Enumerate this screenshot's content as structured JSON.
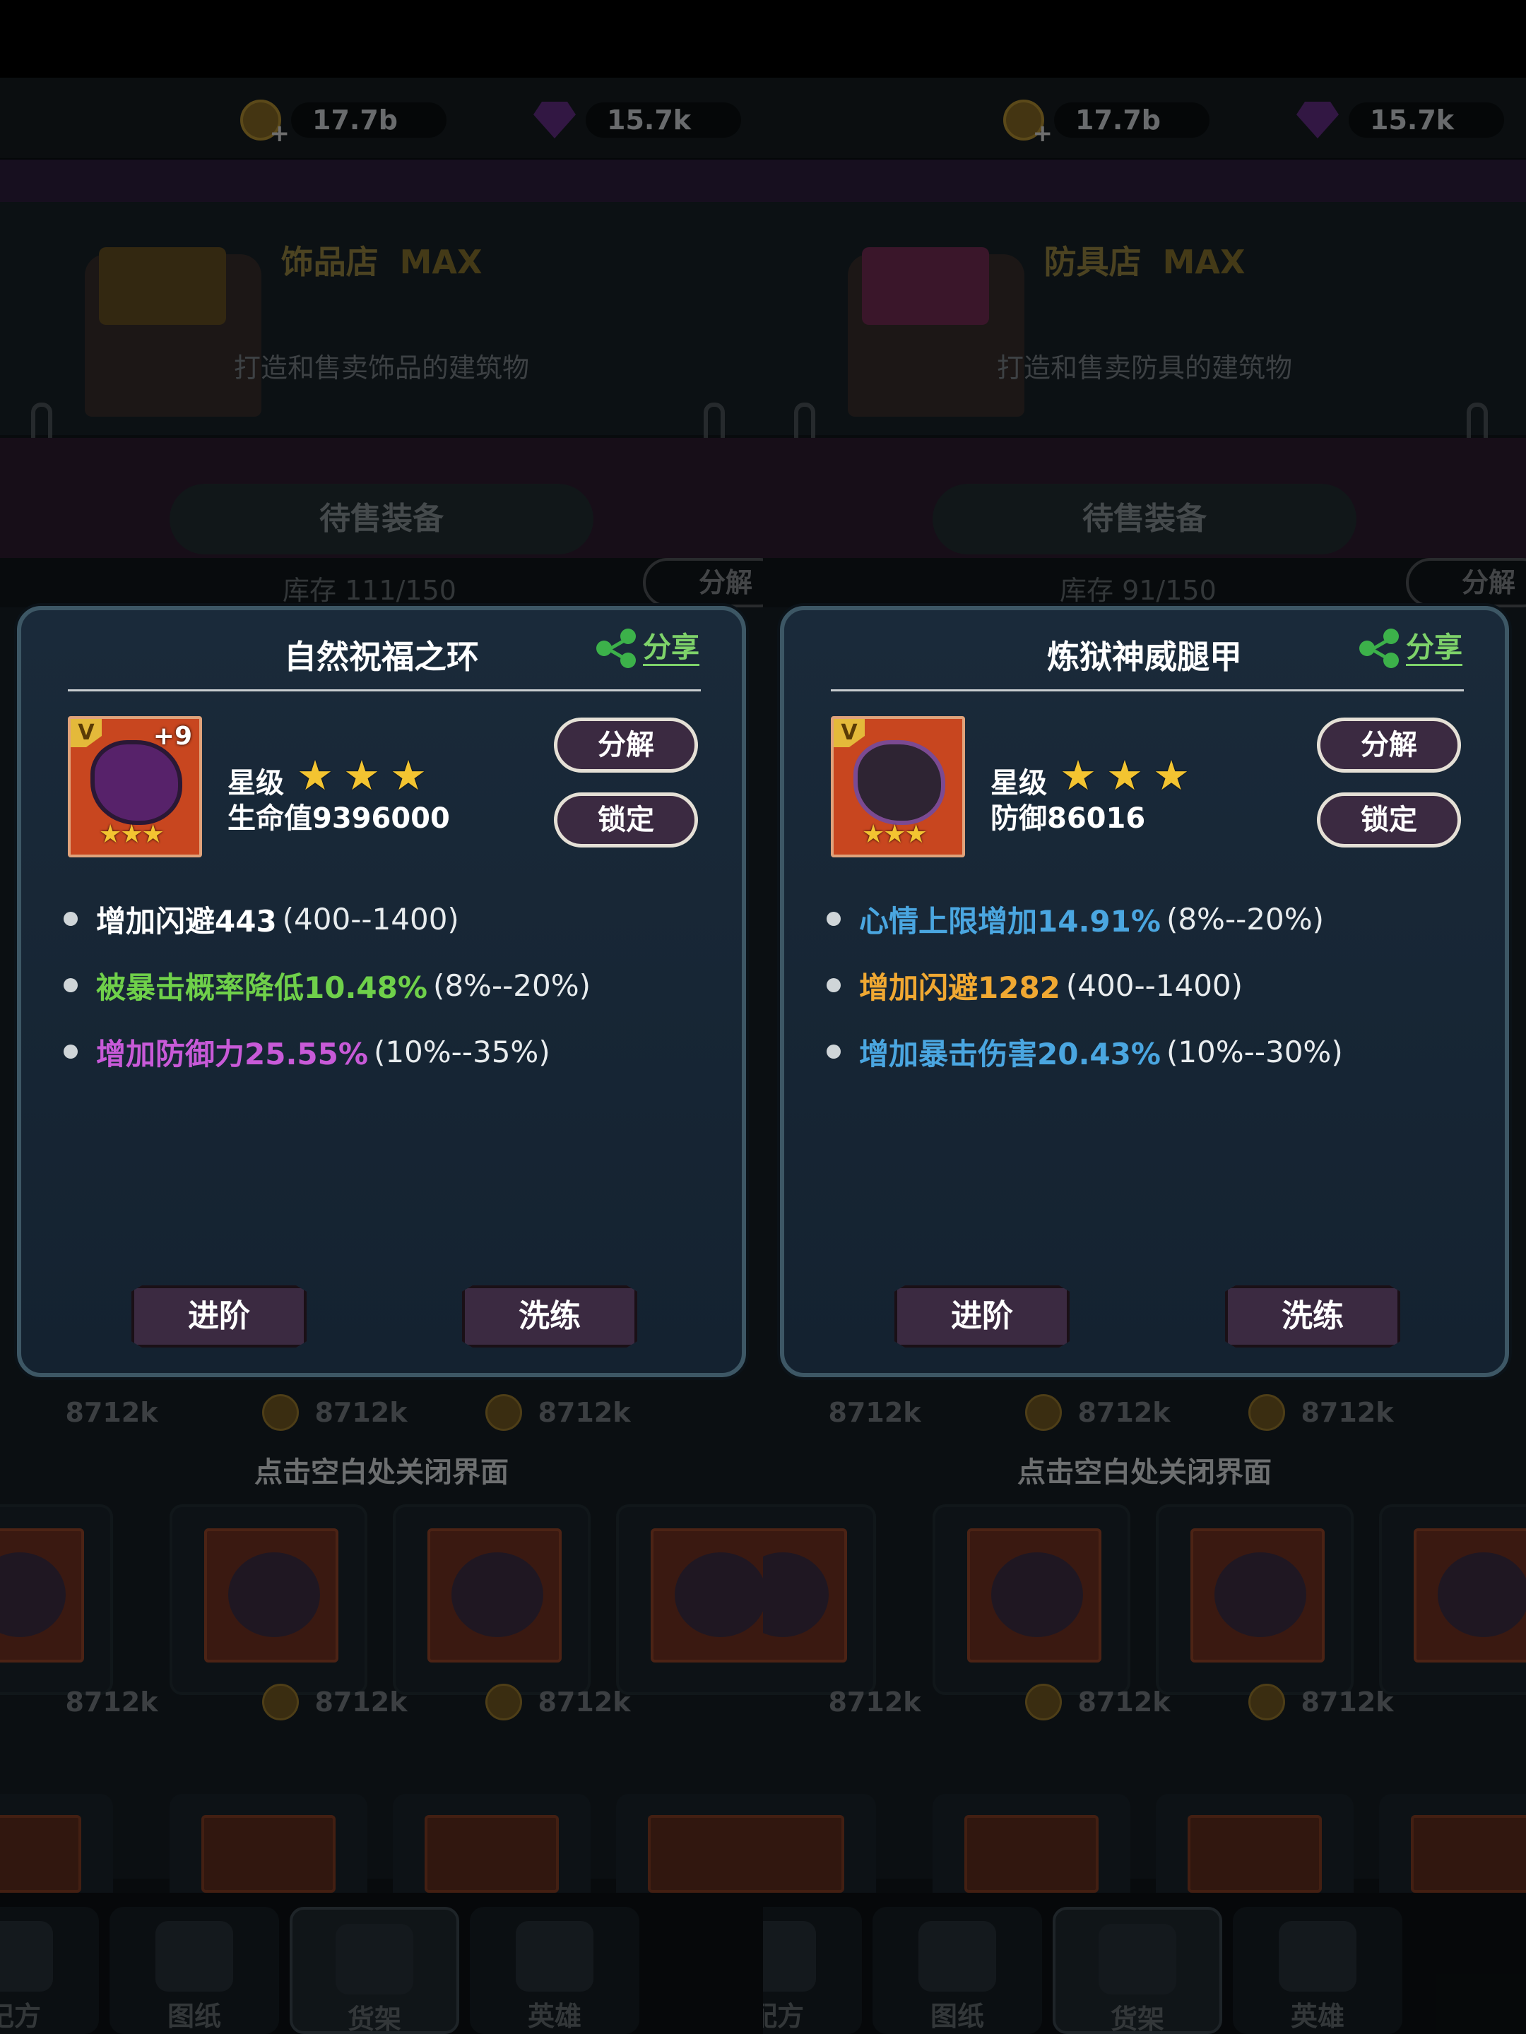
{
  "panels": [
    {
      "currency": {
        "gold": "17.7b",
        "gems": "15.7k"
      },
      "shop": {
        "name": "饰品店",
        "level": "MAX",
        "description": "打造和售卖饰品的建筑物"
      },
      "sale_banner": "待售装备",
      "stock": "库存 111/150",
      "decompose_pill": "分解",
      "item_price": "8712k",
      "close_hint": "点击空白处关闭界面",
      "nav": [
        "记方",
        "图纸",
        "货架",
        "英雄"
      ],
      "modal": {
        "title": "自然祝福之环",
        "share_label": "分享",
        "enhance_level": "+9",
        "badge": "V",
        "star_label": "星级",
        "star_count": 3,
        "main_stat": "生命值9396000",
        "decompose_button": "分解",
        "lock_button": "锁定",
        "attributes": [
          {
            "text": "增加闪避443",
            "range": "(400--1400)",
            "color": "#ffffff"
          },
          {
            "text": "被暴击概率降低10.48%",
            "range": "(8%--20%)",
            "color": "#6fd04a"
          },
          {
            "text": "增加防御力25.55%",
            "range": "(10%--35%)",
            "color": "#c85ad8"
          }
        ],
        "advance_button": "进阶",
        "reforge_button": "洗练"
      }
    },
    {
      "currency": {
        "gold": "17.7b",
        "gems": "15.7k"
      },
      "shop": {
        "name": "防具店",
        "level": "MAX",
        "description": "打造和售卖防具的建筑物"
      },
      "sale_banner": "待售装备",
      "stock": "库存 91/150",
      "decompose_pill": "分解",
      "item_price": "8712k",
      "close_hint": "点击空白处关闭界面",
      "nav": [
        "配方",
        "图纸",
        "货架",
        "英雄"
      ],
      "modal": {
        "title": "炼狱神威腿甲",
        "share_label": "分享",
        "enhance_level": "",
        "badge": "V",
        "star_label": "星级",
        "star_count": 3,
        "main_stat": "防御86016",
        "decompose_button": "分解",
        "lock_button": "锁定",
        "attributes": [
          {
            "text": "心情上限增加14.91%",
            "range": "(8%--20%)",
            "color": "#4aa6e0"
          },
          {
            "text": "增加闪避1282",
            "range": "(400--1400)",
            "color": "#f0a832"
          },
          {
            "text": "增加暴击伤害20.43%",
            "range": "(10%--30%)",
            "color": "#4aa6e0"
          }
        ],
        "advance_button": "进阶",
        "reforge_button": "洗练"
      }
    }
  ]
}
